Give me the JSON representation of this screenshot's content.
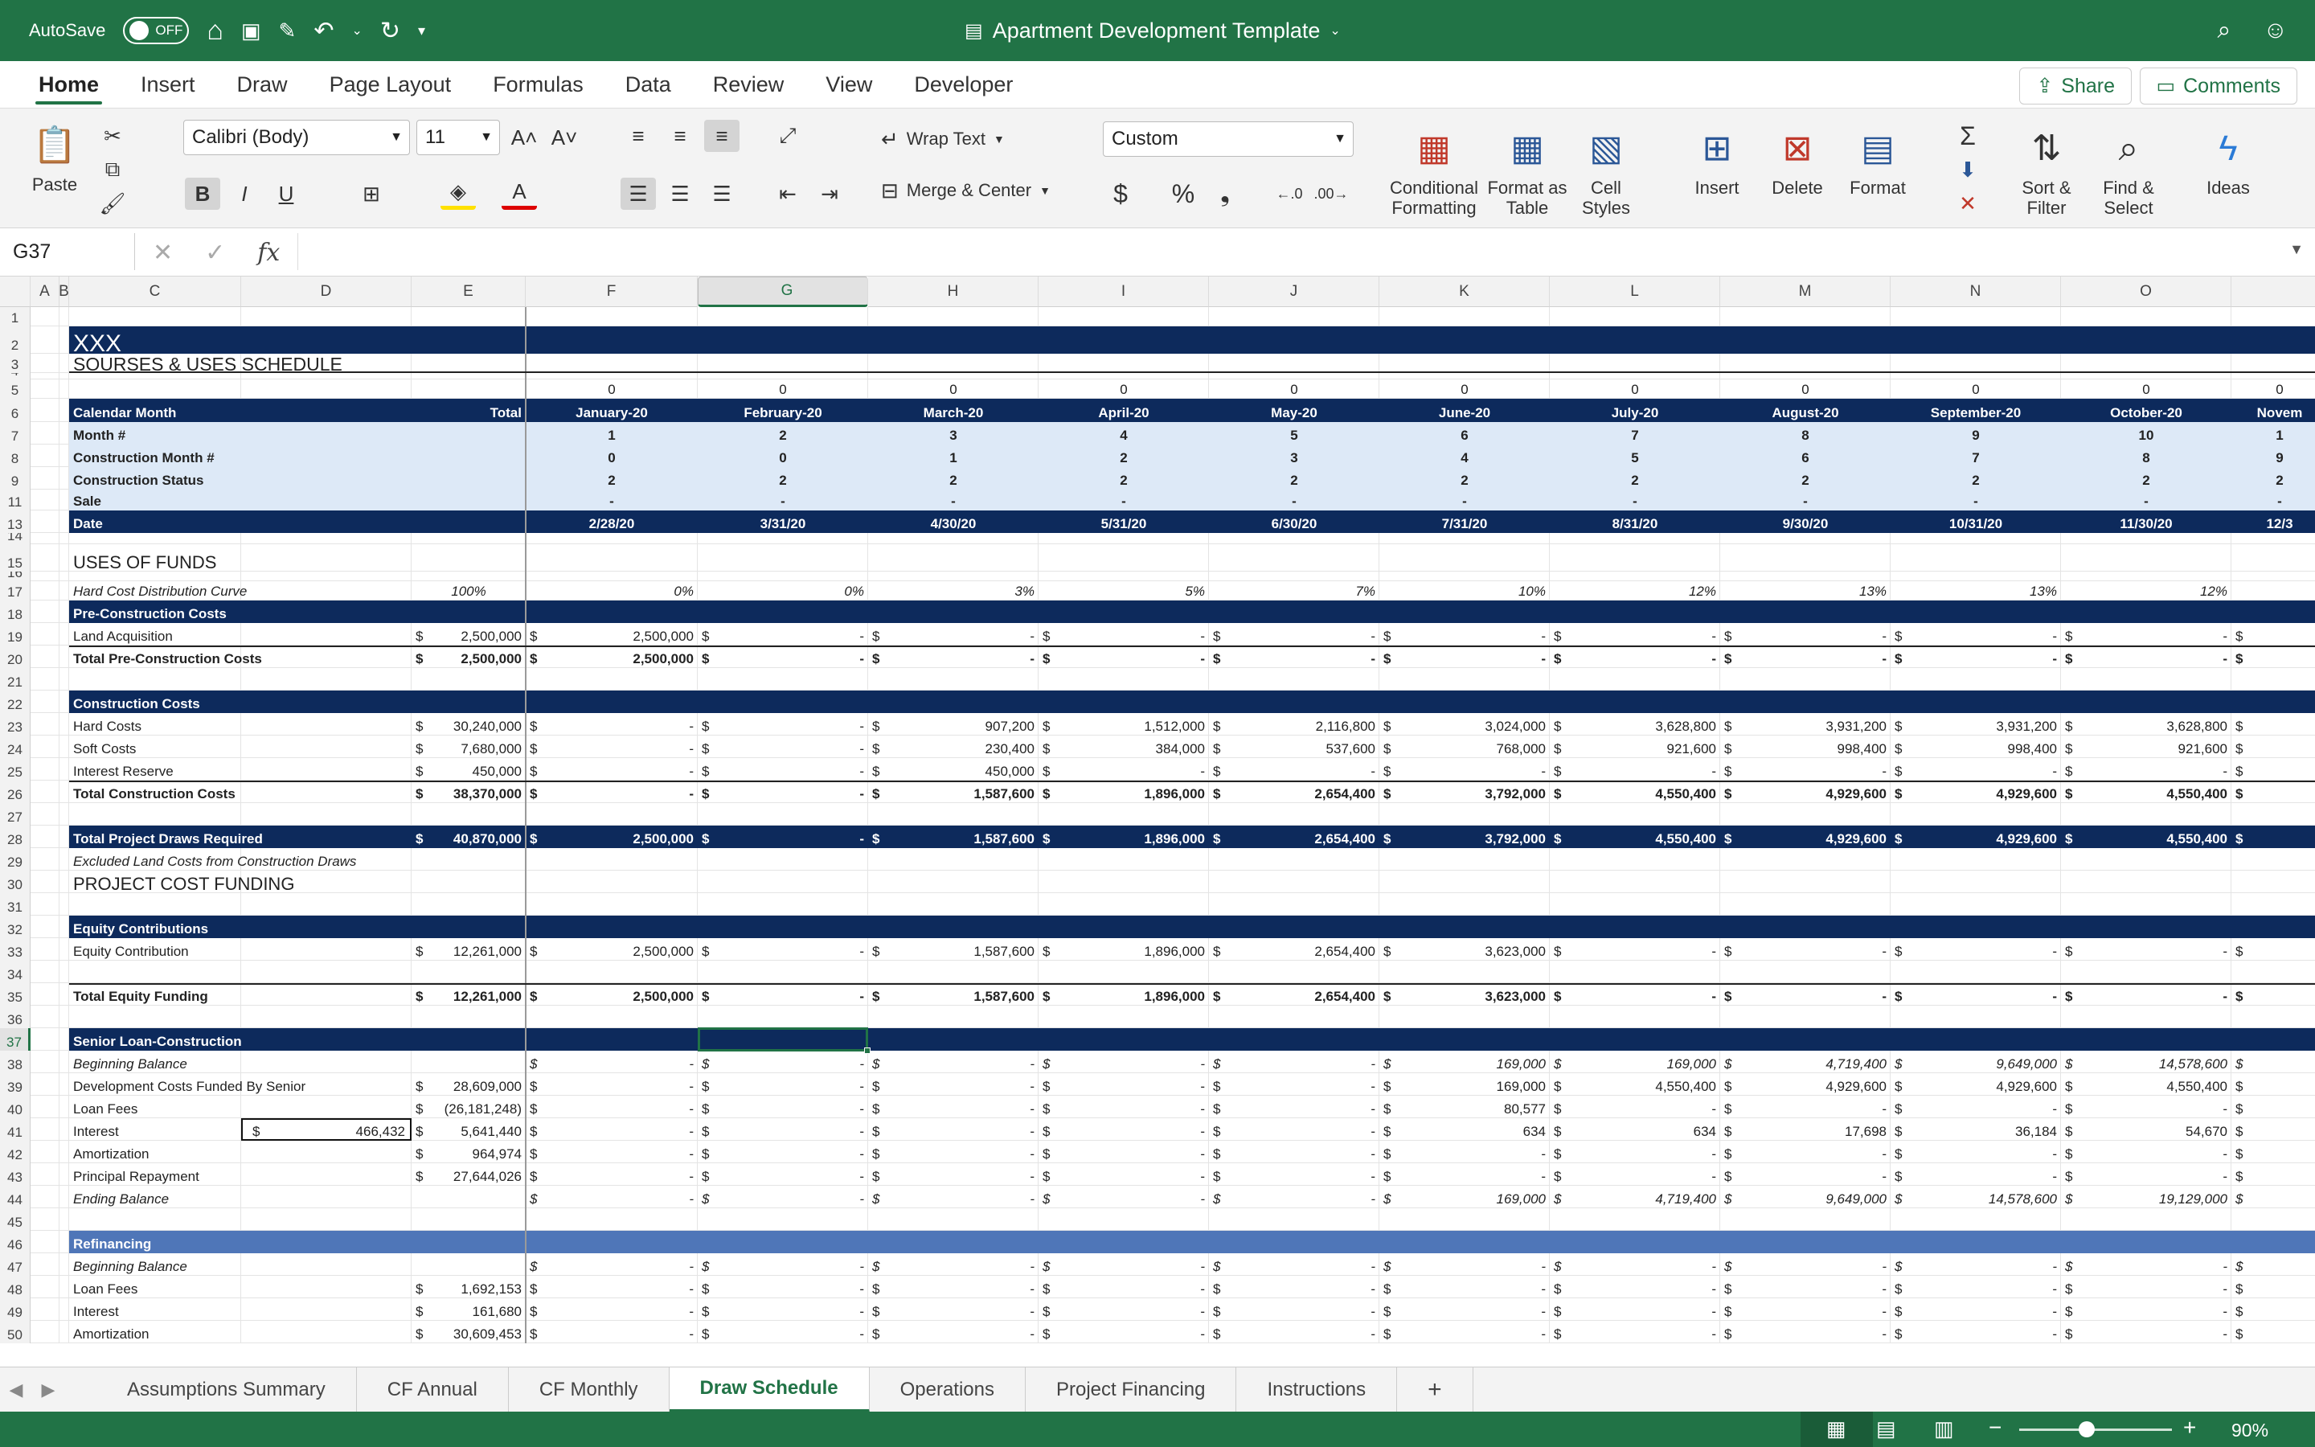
{
  "app": {
    "autosave": "AutoSave",
    "autosave_state": "OFF",
    "doc_title": "Apartment Development Template"
  },
  "ribbon_tabs": [
    "Home",
    "Insert",
    "Draw",
    "Page Layout",
    "Formulas",
    "Data",
    "Review",
    "View",
    "Developer"
  ],
  "share": "Share",
  "comments": "Comments",
  "ribbon": {
    "paste": "Paste",
    "font": "Calibri (Body)",
    "size": "11",
    "wrap": "Wrap Text",
    "merge": "Merge & Center",
    "numfmt": "Custom",
    "cond": "Conditional Formatting",
    "fmt_table": "Format as Table",
    "cell_styles": "Cell Styles",
    "insert": "Insert",
    "delete": "Delete",
    "format": "Format",
    "sort": "Sort & Filter",
    "find": "Find & Select",
    "ideas": "Ideas"
  },
  "namebox": "G37",
  "fx": "fx",
  "columns": [
    "A",
    "B",
    "C",
    "D",
    "E",
    "F",
    "G",
    "H",
    "I",
    "J",
    "K",
    "L",
    "M",
    "N",
    "O"
  ],
  "rows": [
    "1",
    "2",
    "3",
    "4",
    "5",
    "6",
    "7",
    "8",
    "9",
    "11",
    "13",
    "14",
    "15",
    "16",
    "17",
    "18",
    "19",
    "20",
    "21",
    "22",
    "23",
    "24",
    "25",
    "26",
    "27",
    "28",
    "29",
    "30",
    "31",
    "32",
    "33",
    "34",
    "35",
    "36",
    "37",
    "38",
    "39",
    "40",
    "41",
    "42",
    "43",
    "44",
    "45",
    "46",
    "47",
    "48",
    "49",
    "50"
  ],
  "sheet": {
    "xxx": "XXX",
    "sources_uses": "SOURSES & USES SCHEDULE",
    "zeros": [
      "0",
      "0",
      "0",
      "0",
      "0",
      "0",
      "0",
      "0",
      "0",
      "0",
      "0"
    ],
    "calendar_month": "Calendar Month",
    "total": "Total",
    "months": [
      "January-20",
      "February-20",
      "March-20",
      "April-20",
      "May-20",
      "June-20",
      "July-20",
      "August-20",
      "September-20",
      "October-20",
      "Novem"
    ],
    "month_num_lbl": "Month #",
    "month_nums": [
      "1",
      "2",
      "3",
      "4",
      "5",
      "6",
      "7",
      "8",
      "9",
      "10",
      "1"
    ],
    "constr_month_lbl": "Construction Month #",
    "constr_months": [
      "0",
      "0",
      "1",
      "2",
      "3",
      "4",
      "5",
      "6",
      "7",
      "8",
      "9"
    ],
    "constr_status_lbl": "Construction Status",
    "constr_status": [
      "2",
      "2",
      "2",
      "2",
      "2",
      "2",
      "2",
      "2",
      "2",
      "2",
      "2"
    ],
    "sale_lbl": "Sale",
    "sale": [
      "-",
      "-",
      "-",
      "-",
      "-",
      "-",
      "-",
      "-",
      "-",
      "-",
      "-"
    ],
    "date_lbl": "Date",
    "dates": [
      "2/28/20",
      "3/31/20",
      "4/30/20",
      "5/31/20",
      "6/30/20",
      "7/31/20",
      "8/31/20",
      "9/30/20",
      "10/31/20",
      "11/30/20",
      "12/3"
    ],
    "uses_of_funds": "USES OF FUNDS",
    "hc_curve_lbl": "Hard Cost Distribution Curve",
    "hc_curve_total": "100%",
    "hc_curve": [
      "0%",
      "0%",
      "3%",
      "5%",
      "7%",
      "10%",
      "12%",
      "13%",
      "13%",
      "12%"
    ],
    "preconst_hdr": "Pre-Construction Costs",
    "land_lbl": "Land Acquisition",
    "land_total": "2,500,000",
    "land": [
      "2,500,000",
      "-",
      "-",
      "-",
      "-",
      "-",
      "-",
      "-",
      "-",
      "-"
    ],
    "tot_preconst_lbl": "Total Pre-Construction Costs",
    "tot_preconst_total": "2,500,000",
    "tot_preconst": [
      "2,500,000",
      "-",
      "-",
      "-",
      "-",
      "-",
      "-",
      "-",
      "-",
      "-"
    ],
    "const_hdr": "Construction Costs",
    "hard_lbl": "Hard Costs",
    "hard_total": "30,240,000",
    "hard": [
      "-",
      "-",
      "907,200",
      "1,512,000",
      "2,116,800",
      "3,024,000",
      "3,628,800",
      "3,931,200",
      "3,931,200",
      "3,628,800"
    ],
    "soft_lbl": "Soft Costs",
    "soft_total": "7,680,000",
    "soft": [
      "-",
      "-",
      "230,400",
      "384,000",
      "537,600",
      "768,000",
      "921,600",
      "998,400",
      "998,400",
      "921,600"
    ],
    "ir_lbl": "Interest Reserve",
    "ir_total": "450,000",
    "ir": [
      "-",
      "-",
      "450,000",
      "-",
      "-",
      "-",
      "-",
      "-",
      "-",
      "-"
    ],
    "tot_const_lbl": "Total Construction Costs",
    "tot_const_total": "38,370,000",
    "tot_const": [
      "-",
      "-",
      "1,587,600",
      "1,896,000",
      "2,654,400",
      "3,792,000",
      "4,550,400",
      "4,929,600",
      "4,929,600",
      "4,550,400"
    ],
    "tot_draws_lbl": "Total Project Draws Required",
    "tot_draws_total": "40,870,000",
    "tot_draws": [
      "2,500,000",
      "-",
      "1,587,600",
      "1,896,000",
      "2,654,400",
      "3,792,000",
      "4,550,400",
      "4,929,600",
      "4,929,600",
      "4,550,400"
    ],
    "excluded_lbl": "Excluded Land Costs from Construction Draws",
    "project_cost_funding": "PROJECT COST FUNDING",
    "equity_hdr": "Equity Contributions",
    "equity_lbl": "Equity Contribution",
    "equity_total": "12,261,000",
    "equity": [
      "2,500,000",
      "-",
      "1,587,600",
      "1,896,000",
      "2,654,400",
      "3,623,000",
      "-",
      "-",
      "-",
      "-"
    ],
    "tot_equity_lbl": "Total Equity Funding",
    "tot_equity_total": "12,261,000",
    "tot_equity": [
      "2,500,000",
      "-",
      "1,587,600",
      "1,896,000",
      "2,654,400",
      "3,623,000",
      "-",
      "-",
      "-",
      "-"
    ],
    "senior_hdr": "Senior Loan-Construction",
    "beg_bal_lbl": "Beginning Balance",
    "beg_bal": [
      "-",
      "-",
      "-",
      "-",
      "-",
      "169,000",
      "169,000",
      "4,719,400",
      "9,649,000",
      "14,578,600"
    ],
    "dev_costs_lbl": "Development Costs Funded By Senior",
    "dev_costs_total": "28,609,000",
    "dev_costs": [
      "-",
      "-",
      "-",
      "-",
      "-",
      "169,000",
      "4,550,400",
      "4,929,600",
      "4,929,600",
      "4,550,400"
    ],
    "loan_fees_lbl": "Loan Fees",
    "loan_fees_total": "(26,181,248)",
    "loan_fees": [
      "-",
      "-",
      "-",
      "-",
      "-",
      "80,577",
      "-",
      "-",
      "-",
      "-"
    ],
    "interest_lbl": "Interest",
    "interest_d": "466,432",
    "interest_total": "5,641,440",
    "interest": [
      "-",
      "-",
      "-",
      "-",
      "-",
      "634",
      "634",
      "17,698",
      "36,184",
      "54,670"
    ],
    "amort_lbl": "Amortization",
    "amort_total": "964,974",
    "amort": [
      "-",
      "-",
      "-",
      "-",
      "-",
      "-",
      "-",
      "-",
      "-",
      "-"
    ],
    "principal_lbl": "Principal Repayment",
    "principal_total": "27,644,026",
    "principal": [
      "-",
      "-",
      "-",
      "-",
      "-",
      "-",
      "-",
      "-",
      "-",
      "-"
    ],
    "end_bal_lbl": "Ending Balance",
    "end_bal": [
      "-",
      "-",
      "-",
      "-",
      "-",
      "169,000",
      "4,719,400",
      "9,649,000",
      "14,578,600",
      "19,129,000"
    ],
    "refi_hdr": "Refinancing",
    "refi_beg_lbl": "Beginning Balance",
    "refi_beg": [
      "-",
      "-",
      "-",
      "-",
      "-",
      "-",
      "-",
      "-",
      "-",
      "-"
    ],
    "refi_fees_lbl": "Loan Fees",
    "refi_fees_total": "1,692,153",
    "refi_fees": [
      "-",
      "-",
      "-",
      "-",
      "-",
      "-",
      "-",
      "-",
      "-",
      "-"
    ],
    "refi_int_lbl": "Interest",
    "refi_int_total": "161,680",
    "refi_int": [
      "-",
      "-",
      "-",
      "-",
      "-",
      "-",
      "-",
      "-",
      "-",
      "-"
    ],
    "refi_amort_lbl": "Amortization",
    "refi_amort_total": "30,609,453",
    "refi_amort": [
      "-",
      "-",
      "-",
      "-",
      "-",
      "-",
      "-",
      "-",
      "-",
      "-"
    ],
    "dollar": "$"
  },
  "sheet_tabs": [
    "Assumptions Summary",
    "CF Annual",
    "CF Monthly",
    "Draw Schedule",
    "Operations",
    "Project Financing",
    "Instructions"
  ],
  "active_sheet": "Draw Schedule",
  "zoom": "90%",
  "colors": {
    "green": "#217346",
    "navy": "#0d2a5c",
    "lightblue": "#dde9f7",
    "medblue": "#4f76b8"
  }
}
